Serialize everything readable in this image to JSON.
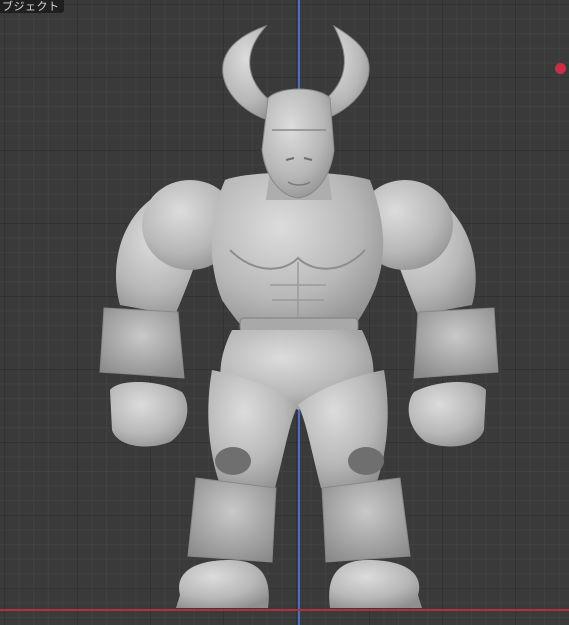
{
  "viewport": {
    "tab_label": "ブジェクト",
    "background_color": "#3a3a3a",
    "grid_color": "#2b2b2b",
    "y_axis_color": "#4b6fc9",
    "x_axis_color": "#b0303f",
    "marker_color": "#cc2c45",
    "model_color": "#bdbdbd"
  },
  "icons": [
    "light-marker-icon"
  ]
}
